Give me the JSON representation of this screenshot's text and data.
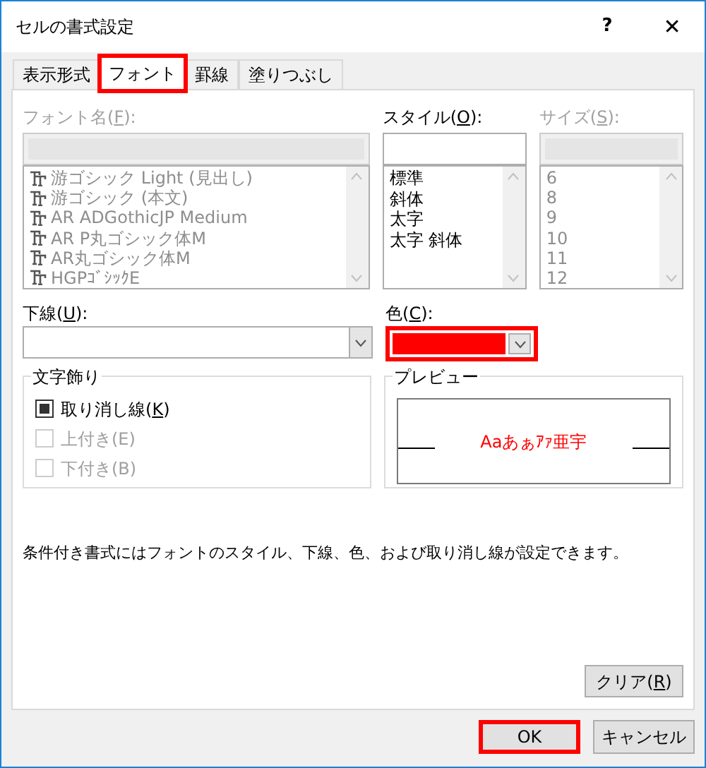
{
  "window": {
    "title": "セルの書式設定",
    "help": "?",
    "close": "✕"
  },
  "tabs": [
    {
      "label": "表示形式",
      "selected": false,
      "highlighted": false
    },
    {
      "label": "フォント",
      "selected": true,
      "highlighted": true
    },
    {
      "label": "罫線",
      "selected": false,
      "highlighted": false
    },
    {
      "label": "塗りつぶし",
      "selected": false,
      "highlighted": false
    }
  ],
  "font_name": {
    "label_parts": [
      "フォント名(",
      "F",
      "):"
    ],
    "disabled": true,
    "items": [
      {
        "label": "游ゴシック Light (見出し)"
      },
      {
        "label": "游ゴシック (本文)"
      },
      {
        "label": "AR ADGothicJP Medium"
      },
      {
        "label": "AR P丸ゴシック体M"
      },
      {
        "label": "AR丸ゴシック体M"
      },
      {
        "label": "HGPｺﾞｼｯｸE"
      }
    ]
  },
  "style": {
    "label_parts": [
      "スタイル(",
      "O",
      "):"
    ],
    "disabled": false,
    "items": [
      {
        "label": "標準"
      },
      {
        "label": "斜体"
      },
      {
        "label": "太字"
      },
      {
        "label": "太字 斜体"
      }
    ]
  },
  "size": {
    "label_parts": [
      "サイズ(",
      "S",
      "):"
    ],
    "disabled": true,
    "items": [
      {
        "label": "6"
      },
      {
        "label": "8"
      },
      {
        "label": "9"
      },
      {
        "label": "10"
      },
      {
        "label": "11"
      },
      {
        "label": "12"
      }
    ]
  },
  "underline": {
    "label_parts": [
      "下線(",
      "U",
      "):"
    ]
  },
  "color": {
    "label_parts": [
      "色(",
      "C",
      "):"
    ],
    "color": "#ff0000",
    "highlighted": true
  },
  "effects": {
    "title": "文字飾り",
    "options": [
      {
        "label_parts": [
          "取り消し線(",
          "K",
          ")"
        ],
        "checked": false,
        "mixed": true,
        "disabled": false
      },
      {
        "label_parts": [
          "上付き(E)"
        ],
        "checked": false,
        "mixed": false,
        "disabled": true
      },
      {
        "label_parts": [
          "下付き(B)"
        ],
        "checked": false,
        "mixed": false,
        "disabled": true
      }
    ]
  },
  "preview": {
    "title": "プレビュー",
    "sample": "Aaあぁｱｧ亜宇",
    "color": "#ff0000"
  },
  "note": "条件付き書式にはフォントのスタイル、下線、色、および取り消し線が設定できます。",
  "clear_button": {
    "label_parts": [
      "クリア(",
      "R",
      ")"
    ]
  },
  "buttons": [
    {
      "label": "OK",
      "highlighted": true
    },
    {
      "label": "キャンセル",
      "highlighted": false
    }
  ]
}
